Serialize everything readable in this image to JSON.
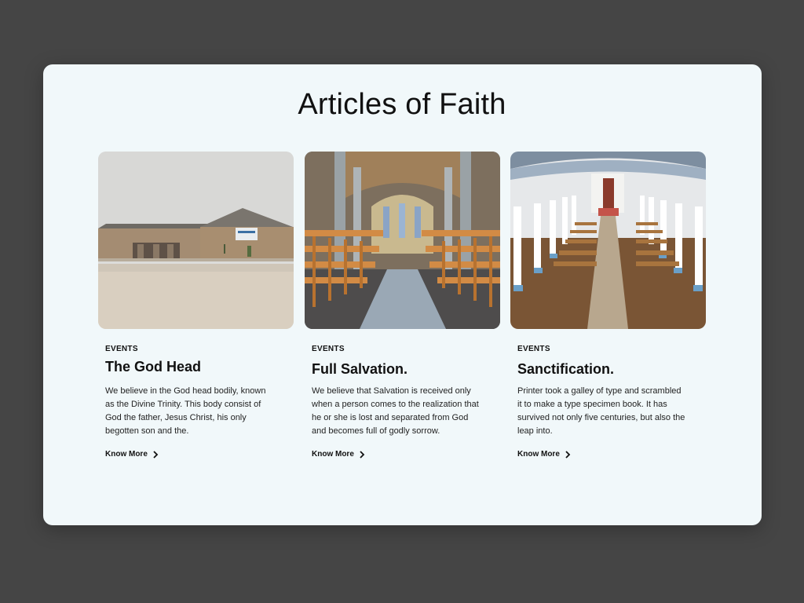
{
  "section": {
    "title": "Articles of Faith"
  },
  "cards": [
    {
      "category": "EVENTS",
      "title": "The God Head",
      "body": "We believe in the God head bodily, known as the Divine Trinity. This body consist of God the father, Jesus Christ, his only begotten son and the.",
      "link": "Know More",
      "image": "church-building-exterior-image"
    },
    {
      "category": "EVENTS",
      "title": "Full Salvation.",
      "body": "We believe that Salvation is received only when a person comes to the realization that he or she is lost and separated from God and becomes full of godly sorrow.",
      "link": "Know More",
      "image": "cathedral-interior-image"
    },
    {
      "category": "EVENTS",
      "title": "Sanctification.",
      "body": "Printer took a galley of type and scrambled it to make a type specimen book. It has survived not only five centuries, but also the leap into.",
      "link": "Know More",
      "image": "chapel-interior-image"
    }
  ],
  "icons": {
    "link_arrow": "chevron-right-icon"
  },
  "colors": {
    "page_background": "#454545",
    "panel_background": "#f1f8fa",
    "text": "#111111"
  }
}
